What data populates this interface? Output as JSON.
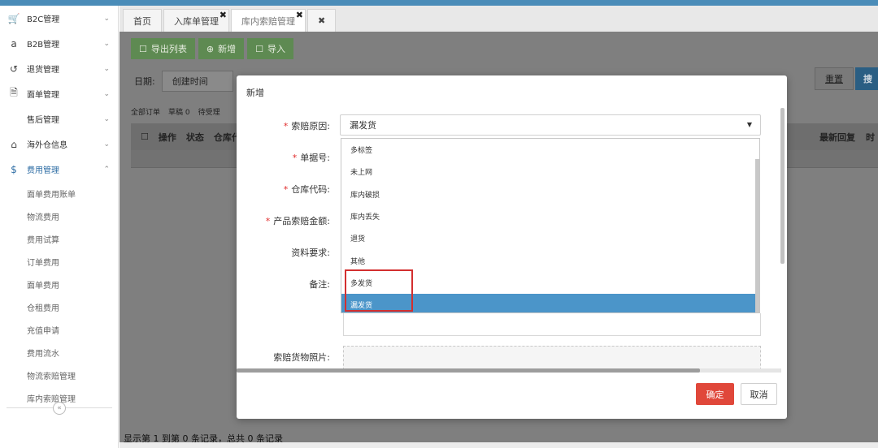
{
  "sidebar": {
    "items": [
      {
        "label": "B2C管理",
        "icon": "cart-icon",
        "glyph": "🛒",
        "chev": "⌄"
      },
      {
        "label": "B2B管理",
        "icon": "amazon-icon",
        "glyph": "a",
        "chev": "⌄"
      },
      {
        "label": "退货管理",
        "icon": "return-icon",
        "glyph": "↺",
        "chev": "⌄"
      },
      {
        "label": "面单管理",
        "icon": "document-icon",
        "glyph": "🗎",
        "chev": "⌄"
      },
      {
        "label": "售后管理",
        "icon": "",
        "glyph": "",
        "chev": "⌄"
      },
      {
        "label": "海外仓信息",
        "icon": "home-icon",
        "glyph": "⌂",
        "chev": "⌄"
      },
      {
        "label": "费用管理",
        "icon": "dollar-icon",
        "glyph": "$",
        "chev": "⌃"
      }
    ],
    "subitems": [
      "面单费用账单",
      "物流费用",
      "费用试算",
      "订单费用",
      "面单费用",
      "仓租费用",
      "充值申请",
      "费用流水",
      "物流索赔管理",
      "库内索赔管理"
    ],
    "collapse_glyph": "«"
  },
  "tabs": [
    {
      "label": "首页",
      "close": ""
    },
    {
      "label": "入库单管理",
      "close": "✖"
    },
    {
      "label": "库内索赔管理",
      "close": "✖"
    },
    {
      "label": "",
      "close": "✖"
    }
  ],
  "toolbar": {
    "export_label": "导出列表",
    "new_label": "新增",
    "import_label": "导入"
  },
  "filter": {
    "date_label": "日期:",
    "date_select": "创建时间",
    "reset_label": "重置",
    "search_label": "搜"
  },
  "subtabs": [
    "全部订单",
    "草稿 0",
    "待受理"
  ],
  "grid": {
    "columns": [
      "操作",
      "状态",
      "仓库代"
    ],
    "right_columns": [
      "最新回复",
      "时"
    ]
  },
  "footer_status": "显示第 1 到第 0 条记录，总共 0 条记录",
  "modal": {
    "title": "新增",
    "fields": {
      "reason": "索赔原因:",
      "order_no": "单据号:",
      "warehouse_code": "仓库代码:",
      "amount": "产品索赔金额:",
      "material": "资料要求:",
      "remark": "备注:",
      "photo": "索赔货物照片:"
    },
    "required_mark": "*",
    "reason_value": "漏发货",
    "dropdown_arrow": "▼",
    "options": [
      "多标签",
      "未上网",
      "库内破损",
      "库内丢失",
      "退货",
      "其他",
      "多发货",
      "漏发货"
    ],
    "selected_option": "漏发货",
    "ok_label": "确定",
    "cancel_label": "取消"
  }
}
